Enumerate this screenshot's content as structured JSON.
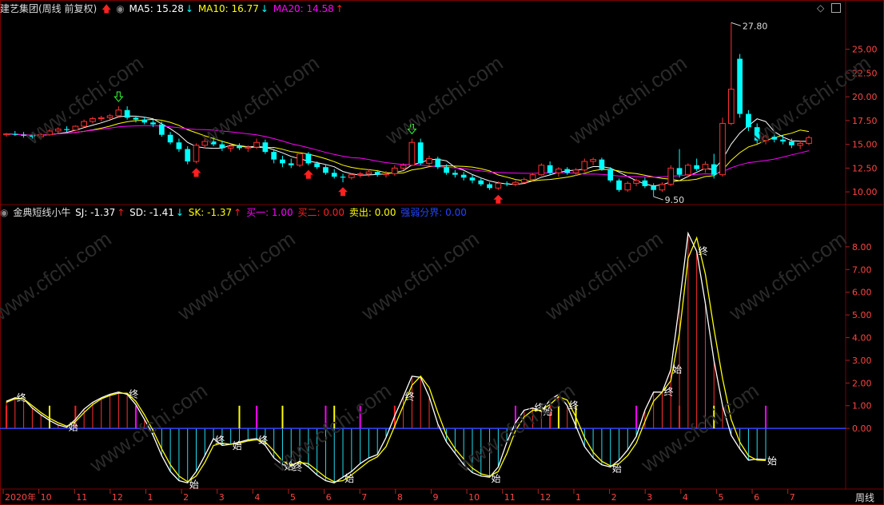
{
  "header_top": {
    "title": "建艺集团(周线 前复权)",
    "ma5": "MA5: 15.28",
    "ma10": "MA10: 16.77",
    "ma20": "MA20: 14.58",
    "colors": {
      "ma5": "#ffffff",
      "ma10": "#ffff00",
      "ma20": "#ff00ff",
      "up_arrow": "#ff2020",
      "down_arrow": "#00ffff"
    }
  },
  "header_bottom": {
    "indicator": "金典短线小牛",
    "sj": "SJ: -1.37",
    "sd": "SD: -1.41",
    "sk": "SK: -1.37",
    "buy1": "买一: 1.00",
    "buy2": "买二: 0.00",
    "sell": "卖出: 0.00",
    "strength": "强弱分界: 0.00"
  },
  "watermark": "www.cfchi.com",
  "timeframe_label": "周线",
  "x_axis_labels": [
    "2020年",
    "10",
    "11",
    "12",
    "1",
    "2",
    "3",
    "4",
    "5",
    "6",
    "7",
    "8",
    "9",
    "10",
    "11",
    "12",
    "1",
    "2",
    "3",
    "4",
    "5",
    "6",
    "7"
  ],
  "chart_data": [
    {
      "type": "candlestick",
      "title": "",
      "ylim": [
        9.0,
        28.5
      ],
      "y_ticks": [
        "25.00",
        "22.50",
        "20.00",
        "17.50",
        "15.00",
        "12.50",
        "10.00"
      ],
      "annotations": [
        {
          "label": "27.80",
          "value": 27.8
        },
        {
          "label": "9.50",
          "value": 9.5
        }
      ],
      "ohlc": [
        [
          16.0,
          16.2,
          15.8,
          16.1
        ],
        [
          16.1,
          16.4,
          15.9,
          16.0
        ],
        [
          16.0,
          16.3,
          15.7,
          15.9
        ],
        [
          15.9,
          16.1,
          15.6,
          15.8
        ],
        [
          15.8,
          16.2,
          15.5,
          16.0
        ],
        [
          16.0,
          16.6,
          15.9,
          16.4
        ],
        [
          16.4,
          16.8,
          16.2,
          16.6
        ],
        [
          16.6,
          16.9,
          16.3,
          16.5
        ],
        [
          16.5,
          17.0,
          16.4,
          16.9
        ],
        [
          16.9,
          17.6,
          16.8,
          17.4
        ],
        [
          17.4,
          17.9,
          17.2,
          17.7
        ],
        [
          17.7,
          18.0,
          17.4,
          17.8
        ],
        [
          17.8,
          18.2,
          17.6,
          18.0
        ],
        [
          18.0,
          19.0,
          17.9,
          18.6
        ],
        [
          18.6,
          19.0,
          17.6,
          17.8
        ],
        [
          17.8,
          18.0,
          17.3,
          17.6
        ],
        [
          17.6,
          17.9,
          17.1,
          17.3
        ],
        [
          17.3,
          17.6,
          16.8,
          17.1
        ],
        [
          17.1,
          17.4,
          15.8,
          16.0
        ],
        [
          16.0,
          16.3,
          15.0,
          15.2
        ],
        [
          15.2,
          15.6,
          14.2,
          14.5
        ],
        [
          14.5,
          14.8,
          12.9,
          13.2
        ],
        [
          13.2,
          15.1,
          13.0,
          14.9
        ],
        [
          14.9,
          15.6,
          14.6,
          15.3
        ],
        [
          15.3,
          15.8,
          14.8,
          15.0
        ],
        [
          15.0,
          15.4,
          14.3,
          14.6
        ],
        [
          14.6,
          15.0,
          14.2,
          14.8
        ],
        [
          14.8,
          15.1,
          14.4,
          14.6
        ],
        [
          14.6,
          14.9,
          14.2,
          14.7
        ],
        [
          14.7,
          15.6,
          14.5,
          15.2
        ],
        [
          15.2,
          15.5,
          14.0,
          14.2
        ],
        [
          14.2,
          14.5,
          13.0,
          13.4
        ],
        [
          13.4,
          13.8,
          12.6,
          13.0
        ],
        [
          13.0,
          13.5,
          12.5,
          12.8
        ],
        [
          12.8,
          14.2,
          12.6,
          14.0
        ],
        [
          14.0,
          14.2,
          12.8,
          13.0
        ],
        [
          13.0,
          13.2,
          12.4,
          12.6
        ],
        [
          12.6,
          12.9,
          11.8,
          12.0
        ],
        [
          12.0,
          12.4,
          11.4,
          11.6
        ],
        [
          11.6,
          11.9,
          11.0,
          11.5
        ],
        [
          11.5,
          12.0,
          11.3,
          11.8
        ],
        [
          11.8,
          12.1,
          11.5,
          11.9
        ],
        [
          11.9,
          12.4,
          11.6,
          12.1
        ],
        [
          12.1,
          12.3,
          11.6,
          11.8
        ],
        [
          11.8,
          12.2,
          11.5,
          11.9
        ],
        [
          11.9,
          12.8,
          11.7,
          12.5
        ],
        [
          12.5,
          13.0,
          12.3,
          12.8
        ],
        [
          12.8,
          15.6,
          12.7,
          15.2
        ],
        [
          15.2,
          15.6,
          12.8,
          13.0
        ],
        [
          13.0,
          13.8,
          12.8,
          13.5
        ],
        [
          13.5,
          13.7,
          12.4,
          12.6
        ],
        [
          12.6,
          12.9,
          11.8,
          12.0
        ],
        [
          12.0,
          12.3,
          11.5,
          11.8
        ],
        [
          11.8,
          12.1,
          11.2,
          11.5
        ],
        [
          11.5,
          11.8,
          10.9,
          11.2
        ],
        [
          11.2,
          11.4,
          10.6,
          10.8
        ],
        [
          10.8,
          11.0,
          10.2,
          10.4
        ],
        [
          10.4,
          11.1,
          10.2,
          10.9
        ],
        [
          10.9,
          11.1,
          10.6,
          10.8
        ],
        [
          10.8,
          11.2,
          10.6,
          11.0
        ],
        [
          11.0,
          11.5,
          10.9,
          11.3
        ],
        [
          11.3,
          12.0,
          11.2,
          11.8
        ],
        [
          11.8,
          13.0,
          11.7,
          12.8
        ],
        [
          12.8,
          13.2,
          11.8,
          12.0
        ],
        [
          12.0,
          12.6,
          11.6,
          12.4
        ],
        [
          12.4,
          12.6,
          11.8,
          12.0
        ],
        [
          12.0,
          12.5,
          11.7,
          12.3
        ],
        [
          12.3,
          13.5,
          12.1,
          13.2
        ],
        [
          13.2,
          13.6,
          12.8,
          13.4
        ],
        [
          13.4,
          13.6,
          12.2,
          12.4
        ],
        [
          12.4,
          12.6,
          11.0,
          11.2
        ],
        [
          11.2,
          11.4,
          10.0,
          10.2
        ],
        [
          10.2,
          11.1,
          10.0,
          10.9
        ],
        [
          10.9,
          11.4,
          10.6,
          11.2
        ],
        [
          11.2,
          11.5,
          10.4,
          10.6
        ],
        [
          10.6,
          10.9,
          9.5,
          10.2
        ],
        [
          10.2,
          11.0,
          10.0,
          10.8
        ],
        [
          10.8,
          12.8,
          10.6,
          12.5
        ],
        [
          12.5,
          14.5,
          11.5,
          11.8
        ],
        [
          11.8,
          13.0,
          11.5,
          12.8
        ],
        [
          12.8,
          13.5,
          12.2,
          12.4
        ],
        [
          12.4,
          13.2,
          12.0,
          12.9
        ],
        [
          12.9,
          14.0,
          11.4,
          11.8
        ],
        [
          11.8,
          17.8,
          11.6,
          17.2
        ],
        [
          17.2,
          27.8,
          17.0,
          20.8
        ],
        [
          24.0,
          24.5,
          17.8,
          18.2
        ],
        [
          18.2,
          18.6,
          16.4,
          16.8
        ],
        [
          16.8,
          17.2,
          15.1,
          15.4
        ],
        [
          15.4,
          16.0,
          15.0,
          15.8
        ],
        [
          15.8,
          16.4,
          15.2,
          15.5
        ],
        [
          15.5,
          16.0,
          15.0,
          15.3
        ],
        [
          15.3,
          15.6,
          14.6,
          14.9
        ],
        [
          14.9,
          15.4,
          14.5,
          15.1
        ],
        [
          15.1,
          15.9,
          14.9,
          15.7
        ]
      ],
      "series": [
        {
          "name": "MA5",
          "color": "#ffffff"
        },
        {
          "name": "MA10",
          "color": "#ffff00"
        },
        {
          "name": "MA20",
          "color": "#ff00ff"
        }
      ],
      "signals": [
        {
          "index": 13,
          "type": "sell"
        },
        {
          "index": 22,
          "type": "buy"
        },
        {
          "index": 35,
          "type": "buy"
        },
        {
          "index": 39,
          "type": "buy"
        },
        {
          "index": 47,
          "type": "sell"
        },
        {
          "index": 57,
          "type": "buy"
        }
      ]
    },
    {
      "type": "line",
      "title": "",
      "ylim": [
        -2.6,
        9.3
      ],
      "y_ticks": [
        "8.00",
        "7.00",
        "6.00",
        "5.00",
        "4.00",
        "3.00",
        "2.00",
        "1.00",
        "0.00"
      ],
      "series": [
        {
          "name": "SJ",
          "color": "#ffffff",
          "values": [
            1.2,
            1.35,
            1.3,
            0.9,
            0.6,
            0.35,
            0.15,
            0.05,
            0.4,
            0.85,
            1.15,
            1.35,
            1.5,
            1.6,
            1.5,
            1.05,
            0.4,
            -0.3,
            -1.2,
            -1.9,
            -2.3,
            -2.4,
            -1.9,
            -1.2,
            -0.45,
            -0.75,
            -0.7,
            -0.6,
            -0.5,
            -0.45,
            -0.75,
            -1.3,
            -1.6,
            -1.65,
            -1.45,
            -1.7,
            -2.05,
            -2.3,
            -2.4,
            -2.15,
            -1.9,
            -1.55,
            -1.3,
            -1.15,
            -0.4,
            0.55,
            1.4,
            2.3,
            2.25,
            1.4,
            0.2,
            -0.6,
            -1.1,
            -1.6,
            -1.95,
            -2.1,
            -2.15,
            -1.7,
            -0.6,
            0.25,
            0.8,
            0.9,
            0.75,
            1.25,
            1.5,
            1.0,
            0.1,
            -0.8,
            -1.3,
            -1.6,
            -1.7,
            -1.4,
            -0.95,
            -0.35,
            0.8,
            1.6,
            1.6,
            2.6,
            5.5,
            8.6,
            7.8,
            5.5,
            3.0,
            1.0,
            -0.3,
            -0.9,
            -1.4,
            -1.35,
            -1.37
          ]
        },
        {
          "name": "SD",
          "color": "#ffff00",
          "values": [
            1.15,
            1.3,
            1.3,
            1.0,
            0.7,
            0.45,
            0.25,
            0.1,
            0.3,
            0.7,
            1.05,
            1.3,
            1.45,
            1.55,
            1.55,
            1.2,
            0.6,
            -0.1,
            -0.9,
            -1.6,
            -2.1,
            -2.35,
            -2.1,
            -1.5,
            -0.75,
            -0.65,
            -0.7,
            -0.65,
            -0.55,
            -0.5,
            -0.6,
            -1.0,
            -1.45,
            -1.6,
            -1.5,
            -1.55,
            -1.85,
            -2.15,
            -2.35,
            -2.3,
            -2.05,
            -1.75,
            -1.45,
            -1.25,
            -0.8,
            0.1,
            1.0,
            1.9,
            2.3,
            1.8,
            0.7,
            -0.3,
            -0.9,
            -1.35,
            -1.75,
            -2.0,
            -2.1,
            -1.9,
            -1.1,
            -0.1,
            0.5,
            0.8,
            0.8,
            1.05,
            1.4,
            1.25,
            0.5,
            -0.4,
            -1.05,
            -1.45,
            -1.65,
            -1.55,
            -1.2,
            -0.65,
            0.3,
            1.2,
            1.6,
            2.1,
            4.2,
            7.5,
            8.4,
            6.8,
            4.4,
            2.2,
            0.4,
            -0.6,
            -1.2,
            -1.4,
            -1.41
          ]
        }
      ],
      "buy_markers": [
        0,
        8,
        45,
        63,
        78
      ],
      "buy_marker_color": "#ff2020",
      "special_markers": [
        {
          "index": 5,
          "color": "#ffff00"
        },
        {
          "index": 15,
          "color": "#ff00ff"
        },
        {
          "index": 27,
          "color": "#ffff00"
        },
        {
          "index": 29,
          "color": "#ff00ff"
        },
        {
          "index": 32,
          "color": "#ffff00"
        },
        {
          "index": 37,
          "color": "#ff00ff"
        },
        {
          "index": 38,
          "color": "#ffff00"
        },
        {
          "index": 41,
          "color": "#ff00ff"
        },
        {
          "index": 59,
          "color": "#ff00ff"
        },
        {
          "index": 64,
          "color": "#ffff00"
        },
        {
          "index": 66,
          "color": "#ffff00"
        },
        {
          "index": 73,
          "color": "#ff00ff"
        },
        {
          "index": 82,
          "color": "#ffff00"
        },
        {
          "index": 88,
          "color": "#ff00ff"
        }
      ],
      "labels": [
        {
          "index": 1,
          "text": "终"
        },
        {
          "index": 7,
          "text": "始"
        },
        {
          "index": 14,
          "text": "终"
        },
        {
          "index": 21,
          "text": "始"
        },
        {
          "index": 24,
          "text": "终"
        },
        {
          "index": 26,
          "text": "始"
        },
        {
          "index": 29,
          "text": "终"
        },
        {
          "index": 32,
          "text": "始"
        },
        {
          "index": 33,
          "text": "终"
        },
        {
          "index": 39,
          "text": "始"
        },
        {
          "index": 46,
          "text": "终"
        },
        {
          "index": 56,
          "text": "始"
        },
        {
          "index": 61,
          "text": "终"
        },
        {
          "index": 62,
          "text": "始"
        },
        {
          "index": 65,
          "text": "终"
        },
        {
          "index": 70,
          "text": "始"
        },
        {
          "index": 76,
          "text": "终"
        },
        {
          "index": 77,
          "text": "始"
        },
        {
          "index": 80,
          "text": "终"
        },
        {
          "index": 88,
          "text": "始"
        }
      ]
    }
  ]
}
